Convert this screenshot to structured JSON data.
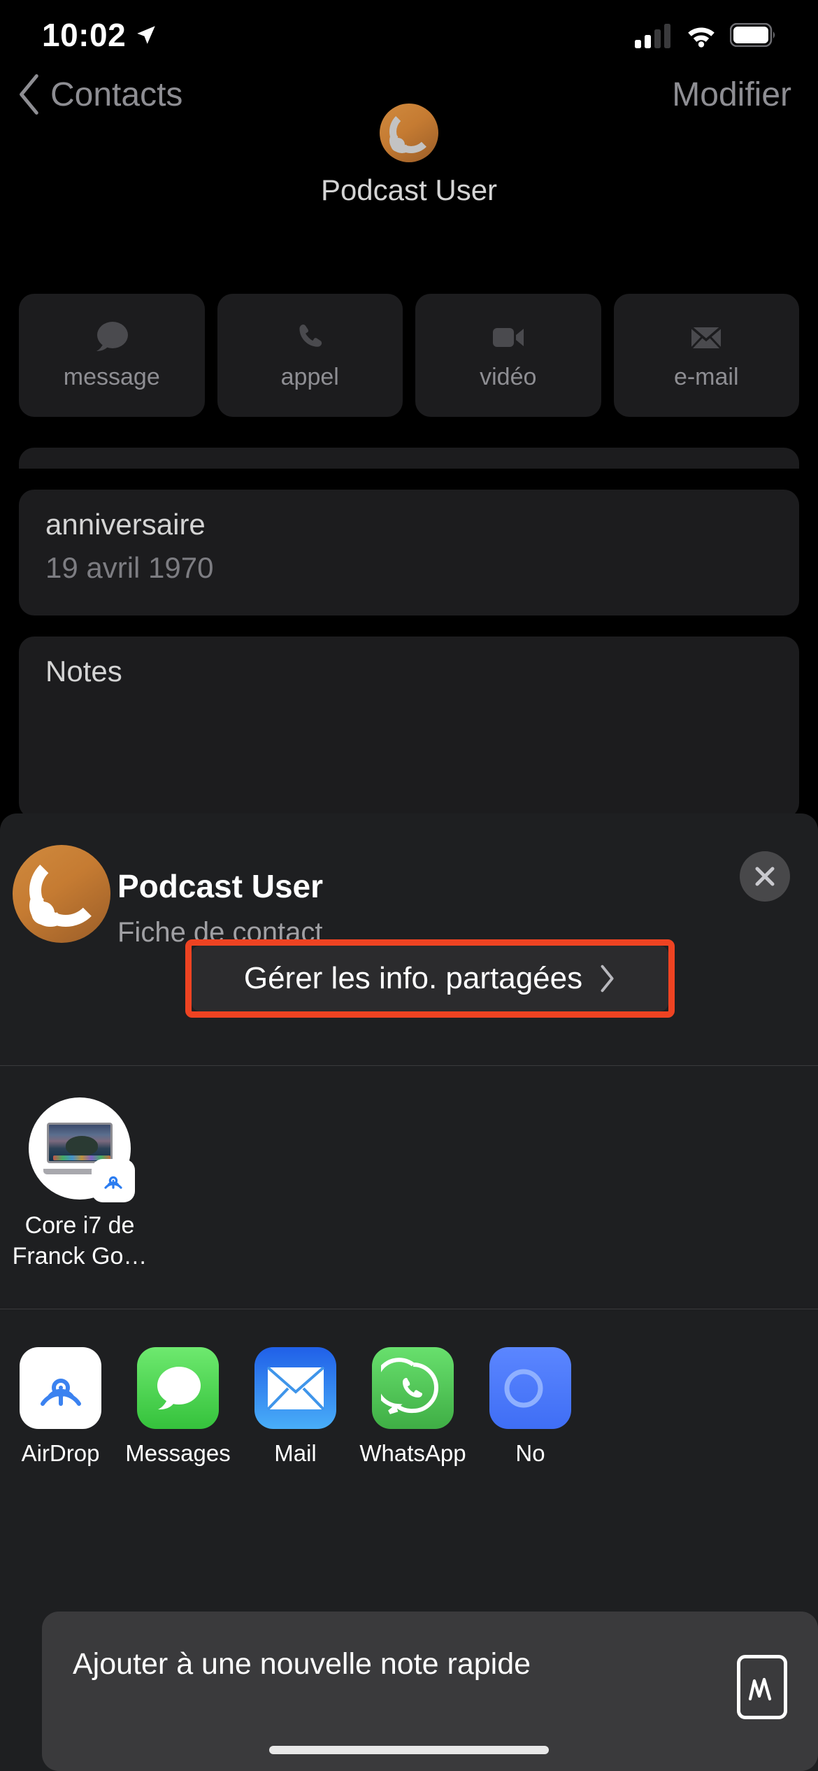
{
  "status_bar": {
    "time": "10:02",
    "location_icon": "location-arrow-icon",
    "cellular_icon": "cellular-bars-icon",
    "cellular_bars_filled": 2,
    "cellular_bars_total": 4,
    "wifi_icon": "wifi-icon",
    "battery_icon": "battery-icon"
  },
  "nav_bar": {
    "back_label": "Contacts",
    "back_icon": "chevron-left-icon",
    "edit_label": "Modifier"
  },
  "contact": {
    "avatar_icon": "rss-podcast-icon",
    "name": "Podcast User",
    "actions": [
      {
        "label": "message",
        "icon": "message-bubble-icon"
      },
      {
        "label": "appel",
        "icon": "phone-icon"
      },
      {
        "label": "vidéo",
        "icon": "video-camera-icon"
      },
      {
        "label": "e-mail",
        "icon": "envelope-icon"
      }
    ],
    "fields": [
      {
        "label": "anniversaire",
        "value": "19 avril 1970"
      },
      {
        "label": "Notes",
        "value": ""
      }
    ]
  },
  "share_sheet": {
    "avatar_icon": "rss-podcast-icon",
    "title": "Podcast User",
    "subtitle": "Fiche de contact",
    "close_icon": "close-x-icon",
    "manage_button": {
      "label": "Gérer les info. partagées",
      "chevron_icon": "chevron-right-icon",
      "highlight_color": "#ee4322"
    },
    "devices": [
      {
        "name": "Core i7 de Franck Go…",
        "device_icon": "macbook-icon",
        "badge_icon": "airdrop-icon"
      }
    ],
    "apps": [
      {
        "label": "AirDrop",
        "icon": "airdrop-icon",
        "color": "#ffffff"
      },
      {
        "label": "Messages",
        "icon": "messages-icon",
        "color": "#5fd865"
      },
      {
        "label": "Mail",
        "icon": "mail-icon",
        "color": "#1d8cf5"
      },
      {
        "label": "WhatsApp",
        "icon": "whatsapp-icon",
        "color": "#4ec95b"
      },
      {
        "label": "No",
        "icon": "notes-icon",
        "color": "#4a7afd"
      }
    ],
    "bottom_action": {
      "label": "Ajouter à une nouvelle note rapide",
      "icon": "quick-note-icon"
    }
  }
}
